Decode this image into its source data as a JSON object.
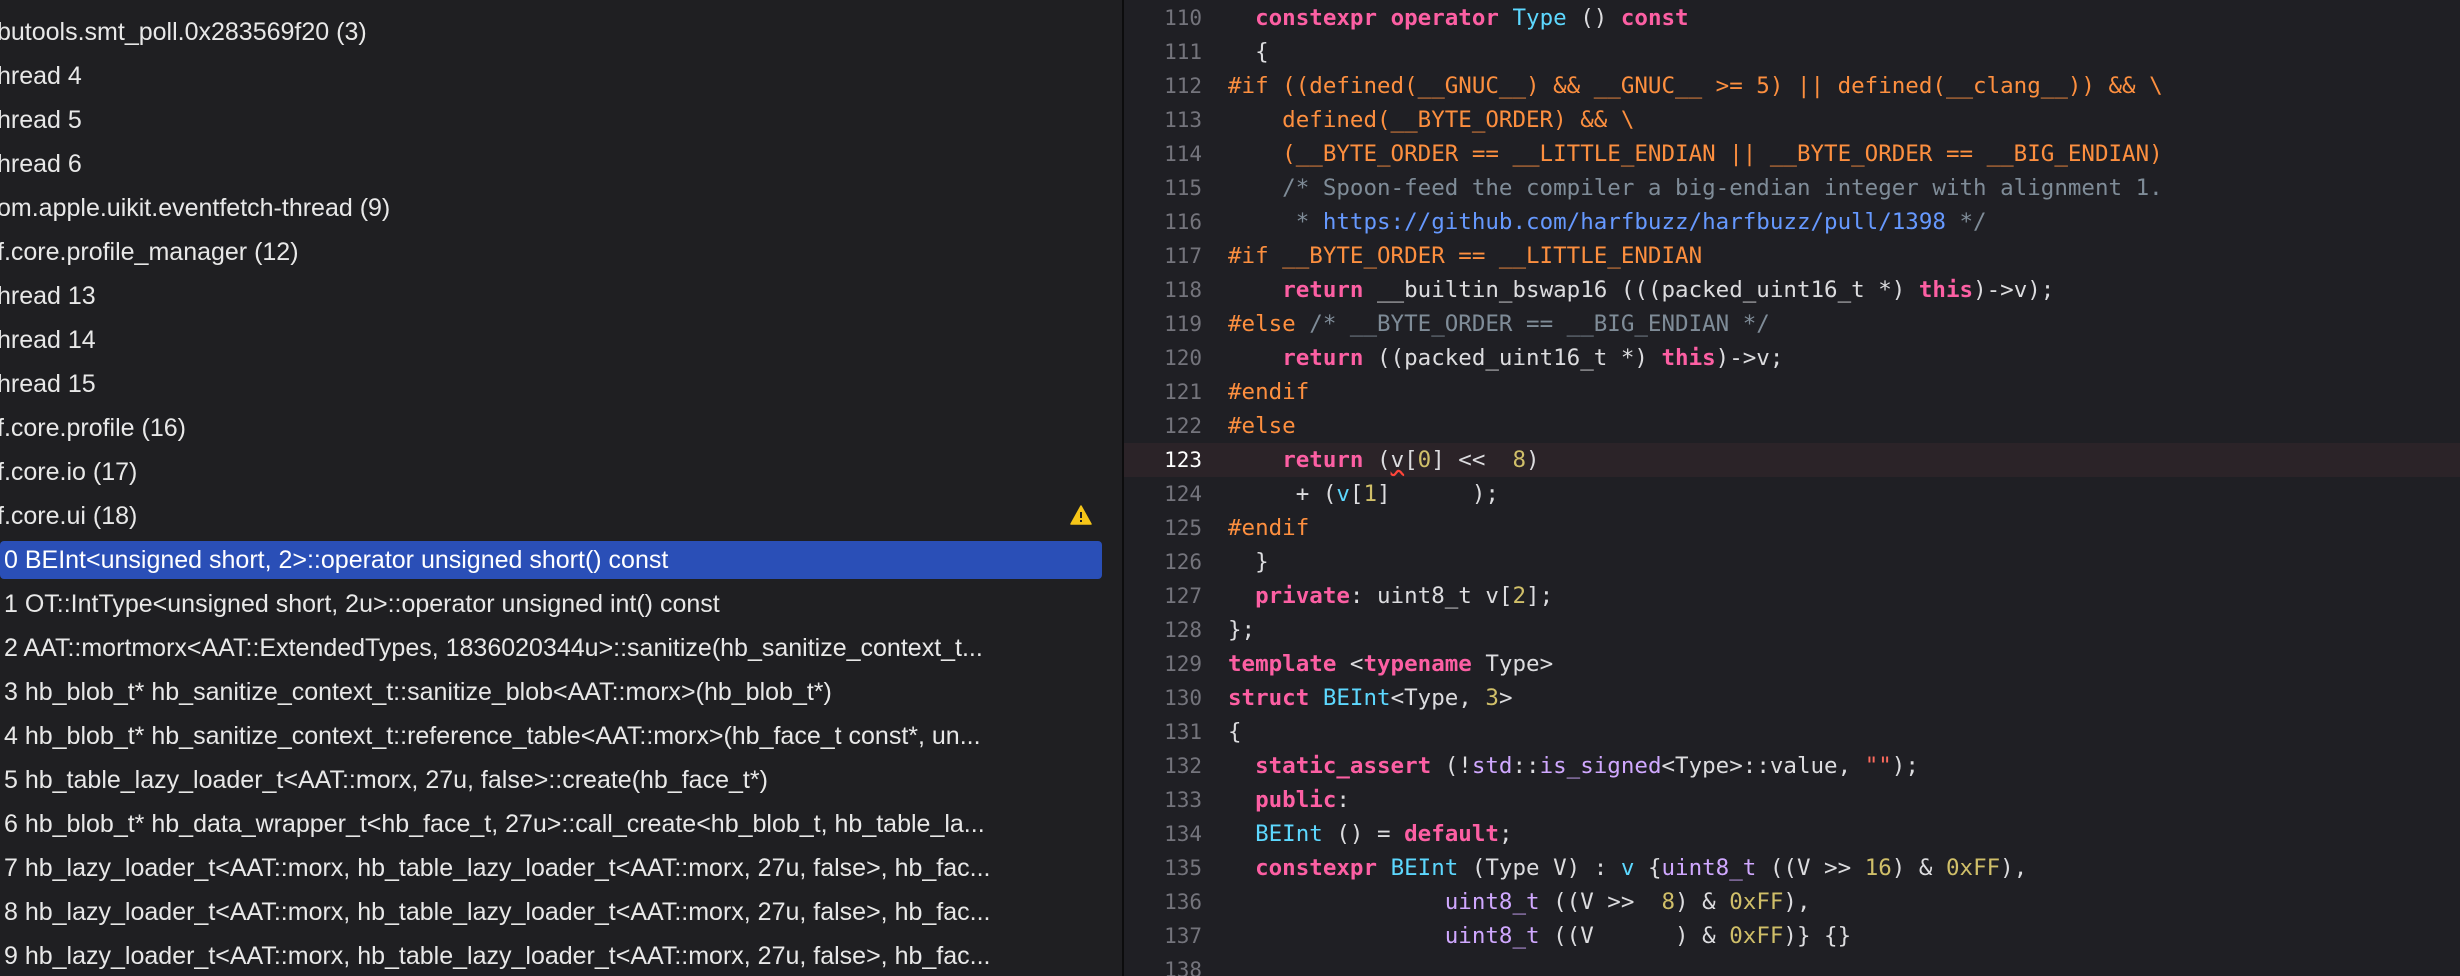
{
  "navigator": {
    "threads": [
      {
        "label": "butools.smt_poll.0x283569f20 (3)",
        "warning": false
      },
      {
        "label": "hread 4",
        "warning": false
      },
      {
        "label": "hread 5",
        "warning": false
      },
      {
        "label": "hread 6",
        "warning": false
      },
      {
        "label": "om.apple.uikit.eventfetch-thread (9)",
        "warning": false
      },
      {
        "label": "f.core.profile_manager (12)",
        "warning": false
      },
      {
        "label": "hread 13",
        "warning": false
      },
      {
        "label": "hread 14",
        "warning": false
      },
      {
        "label": "hread 15",
        "warning": false
      },
      {
        "label": "f.core.profile (16)",
        "warning": false
      },
      {
        "label": "f.core.io (17)",
        "warning": false
      },
      {
        "label": "f.core.ui (18)",
        "warning": true
      }
    ],
    "frames": [
      {
        "label": "0 BEInt<unsigned short, 2>::operator unsigned short() const",
        "selected": true
      },
      {
        "label": "1 OT::IntType<unsigned short, 2u>::operator unsigned int() const",
        "selected": false
      },
      {
        "label": "2 AAT::mortmorx<AAT::ExtendedTypes, 1836020344u>::sanitize(hb_sanitize_context_t...",
        "selected": false
      },
      {
        "label": "3 hb_blob_t* hb_sanitize_context_t::sanitize_blob<AAT::morx>(hb_blob_t*)",
        "selected": false
      },
      {
        "label": "4 hb_blob_t* hb_sanitize_context_t::reference_table<AAT::morx>(hb_face_t const*, un...",
        "selected": false
      },
      {
        "label": "5 hb_table_lazy_loader_t<AAT::morx, 27u, false>::create(hb_face_t*)",
        "selected": false
      },
      {
        "label": "6 hb_blob_t* hb_data_wrapper_t<hb_face_t, 27u>::call_create<hb_blob_t, hb_table_la...",
        "selected": false
      },
      {
        "label": "7 hb_lazy_loader_t<AAT::morx, hb_table_lazy_loader_t<AAT::morx, 27u, false>, hb_fac...",
        "selected": false
      },
      {
        "label": "8 hb_lazy_loader_t<AAT::morx, hb_table_lazy_loader_t<AAT::morx, 27u, false>, hb_fac...",
        "selected": false
      },
      {
        "label": "9 hb_lazy_loader_t<AAT::morx, hb_table_lazy_loader_t<AAT::morx, 27u, false>, hb_fac...",
        "selected": false
      }
    ]
  },
  "editor": {
    "current_line": 123,
    "lines": [
      {
        "n": 110,
        "tokens": [
          [
            "",
            "  "
          ],
          [
            "kw",
            "constexpr"
          ],
          [
            "",
            " "
          ],
          [
            "kw",
            "operator"
          ],
          [
            "",
            " "
          ],
          [
            "tyb",
            "Type"
          ],
          [
            "",
            " () "
          ],
          [
            "kw",
            "const"
          ]
        ]
      },
      {
        "n": 111,
        "tokens": [
          [
            "",
            "  {"
          ]
        ]
      },
      {
        "n": 112,
        "tokens": [
          [
            "pp",
            "#if ((defined(__GNUC__) && __GNUC__ >= 5) || defined(__clang__)) && \\"
          ]
        ]
      },
      {
        "n": 113,
        "tokens": [
          [
            "pp",
            "    defined(__BYTE_ORDER) && \\"
          ]
        ]
      },
      {
        "n": 114,
        "tokens": [
          [
            "pp",
            "    (__BYTE_ORDER == __LITTLE_ENDIAN || __BYTE_ORDER == __BIG_ENDIAN)"
          ]
        ]
      },
      {
        "n": 115,
        "tokens": [
          [
            "cm",
            "    /* Spoon-feed the compiler a big-endian integer with alignment 1."
          ]
        ]
      },
      {
        "n": 116,
        "tokens": [
          [
            "cm",
            "     * "
          ],
          [
            "url",
            "https://github.com/harfbuzz/harfbuzz/pull/1398"
          ],
          [
            "cm",
            " */"
          ]
        ]
      },
      {
        "n": 117,
        "tokens": [
          [
            "pp",
            "#if __BYTE_ORDER == __LITTLE_ENDIAN"
          ]
        ]
      },
      {
        "n": 118,
        "tokens": [
          [
            "",
            "    "
          ],
          [
            "kw",
            "return"
          ],
          [
            "",
            " __builtin_bswap16 (((packed_uint16_t *) "
          ],
          [
            "kw",
            "this"
          ],
          [
            "",
            ")->v);"
          ]
        ]
      },
      {
        "n": 119,
        "tokens": [
          [
            "pp",
            "#else"
          ],
          [
            "",
            " "
          ],
          [
            "cm",
            "/* __BYTE_ORDER == __BIG_ENDIAN */"
          ]
        ]
      },
      {
        "n": 120,
        "tokens": [
          [
            "",
            "    "
          ],
          [
            "kw",
            "return"
          ],
          [
            "",
            " ((packed_uint16_t *) "
          ],
          [
            "kw",
            "this"
          ],
          [
            "",
            ")->v;"
          ]
        ]
      },
      {
        "n": 121,
        "tokens": [
          [
            "pp",
            "#endif"
          ]
        ]
      },
      {
        "n": 122,
        "tokens": [
          [
            "pp",
            "#else"
          ]
        ]
      },
      {
        "n": 123,
        "tokens": [
          [
            "",
            "    "
          ],
          [
            "kw",
            "return"
          ],
          [
            "",
            " ("
          ],
          [
            "err",
            "v"
          ],
          [
            "",
            "["
          ],
          [
            "num",
            "0"
          ],
          [
            "",
            "] <<  "
          ],
          [
            "num",
            "8"
          ],
          [
            "",
            ")"
          ]
        ]
      },
      {
        "n": 124,
        "tokens": [
          [
            "",
            "     + ("
          ],
          [
            "tyb",
            "v"
          ],
          [
            "",
            "["
          ],
          [
            "num",
            "1"
          ],
          [
            "",
            "]      );"
          ]
        ]
      },
      {
        "n": 125,
        "tokens": [
          [
            "pp",
            "#endif"
          ]
        ]
      },
      {
        "n": 126,
        "tokens": [
          [
            "",
            "  }"
          ]
        ]
      },
      {
        "n": 127,
        "tokens": [
          [
            "",
            "  "
          ],
          [
            "kw",
            "private"
          ],
          [
            "",
            ": uint8_t v["
          ],
          [
            "num",
            "2"
          ],
          [
            "",
            "];"
          ]
        ]
      },
      {
        "n": 128,
        "tokens": [
          [
            "",
            "};"
          ]
        ]
      },
      {
        "n": 129,
        "tokens": [
          [
            "kw",
            "template"
          ],
          [
            "",
            " <"
          ],
          [
            "kw",
            "typename"
          ],
          [
            "",
            " Type>"
          ]
        ]
      },
      {
        "n": 130,
        "tokens": [
          [
            "kw",
            "struct"
          ],
          [
            "",
            " "
          ],
          [
            "tyb",
            "BEInt"
          ],
          [
            "",
            "<Type, "
          ],
          [
            "num",
            "3"
          ],
          [
            "",
            ">"
          ]
        ]
      },
      {
        "n": 131,
        "tokens": [
          [
            "",
            "{"
          ]
        ]
      },
      {
        "n": 132,
        "tokens": [
          [
            "",
            "  "
          ],
          [
            "kw",
            "static_assert"
          ],
          [
            "",
            " (!"
          ],
          [
            "ty",
            "std"
          ],
          [
            "",
            "::"
          ],
          [
            "ty",
            "is_signed"
          ],
          [
            "",
            "<Type>::value, "
          ],
          [
            "str",
            "\"\""
          ],
          [
            "",
            ");"
          ]
        ]
      },
      {
        "n": 133,
        "tokens": [
          [
            "",
            "  "
          ],
          [
            "kw",
            "public"
          ],
          [
            "",
            ":"
          ]
        ]
      },
      {
        "n": 134,
        "tokens": [
          [
            "",
            "  "
          ],
          [
            "tyb",
            "BEInt"
          ],
          [
            "",
            " () = "
          ],
          [
            "kw",
            "default"
          ],
          [
            "",
            ";"
          ]
        ]
      },
      {
        "n": 135,
        "tokens": [
          [
            "",
            "  "
          ],
          [
            "kw",
            "constexpr"
          ],
          [
            "",
            " "
          ],
          [
            "tyb",
            "BEInt"
          ],
          [
            "",
            " (Type V) : "
          ],
          [
            "tyb",
            "v"
          ],
          [
            "",
            " {"
          ],
          [
            "ty",
            "uint8_t"
          ],
          [
            "",
            " ((V >> "
          ],
          [
            "num",
            "16"
          ],
          [
            "",
            ") & "
          ],
          [
            "num",
            "0xFF"
          ],
          [
            "",
            "),"
          ]
        ]
      },
      {
        "n": 136,
        "tokens": [
          [
            "",
            "                "
          ],
          [
            "ty",
            "uint8_t"
          ],
          [
            "",
            " ((V >>  "
          ],
          [
            "num",
            "8"
          ],
          [
            "",
            ") & "
          ],
          [
            "num",
            "0xFF"
          ],
          [
            "",
            "),"
          ]
        ]
      },
      {
        "n": 137,
        "tokens": [
          [
            "",
            "                "
          ],
          [
            "ty",
            "uint8_t"
          ],
          [
            "",
            " ((V      ) & "
          ],
          [
            "num",
            "0xFF"
          ],
          [
            "",
            ")} {}"
          ]
        ]
      },
      {
        "n": 138,
        "tokens": [
          [
            "",
            ""
          ]
        ]
      }
    ]
  }
}
